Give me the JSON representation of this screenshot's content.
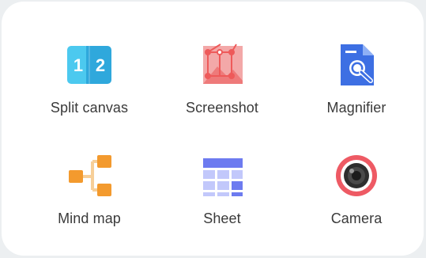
{
  "tools": [
    {
      "label": "Split canvas",
      "icon": "split-canvas-icon",
      "split_digits": [
        "1",
        "2"
      ]
    },
    {
      "label": "Screenshot",
      "icon": "screenshot-icon"
    },
    {
      "label": "Magnifier",
      "icon": "magnifier-icon"
    },
    {
      "label": "Mind map",
      "icon": "mind-map-icon"
    },
    {
      "label": "Sheet",
      "icon": "sheet-icon"
    },
    {
      "label": "Camera",
      "icon": "camera-icon"
    }
  ],
  "colors": {
    "split_left": "#4cc9ef",
    "split_right": "#2fa8dc",
    "screenshot_bg": "#f3a8a8",
    "screenshot_accent": "#ee5a5a",
    "magnifier_blue": "#3d6fe3",
    "mind_map_orange": "#f39a2e",
    "mind_map_line": "#f7cf98",
    "sheet_dark": "#6d7bf0",
    "sheet_light": "#c2c8fb",
    "camera_red": "#ee5a64",
    "label_text": "#3a3a3a"
  }
}
